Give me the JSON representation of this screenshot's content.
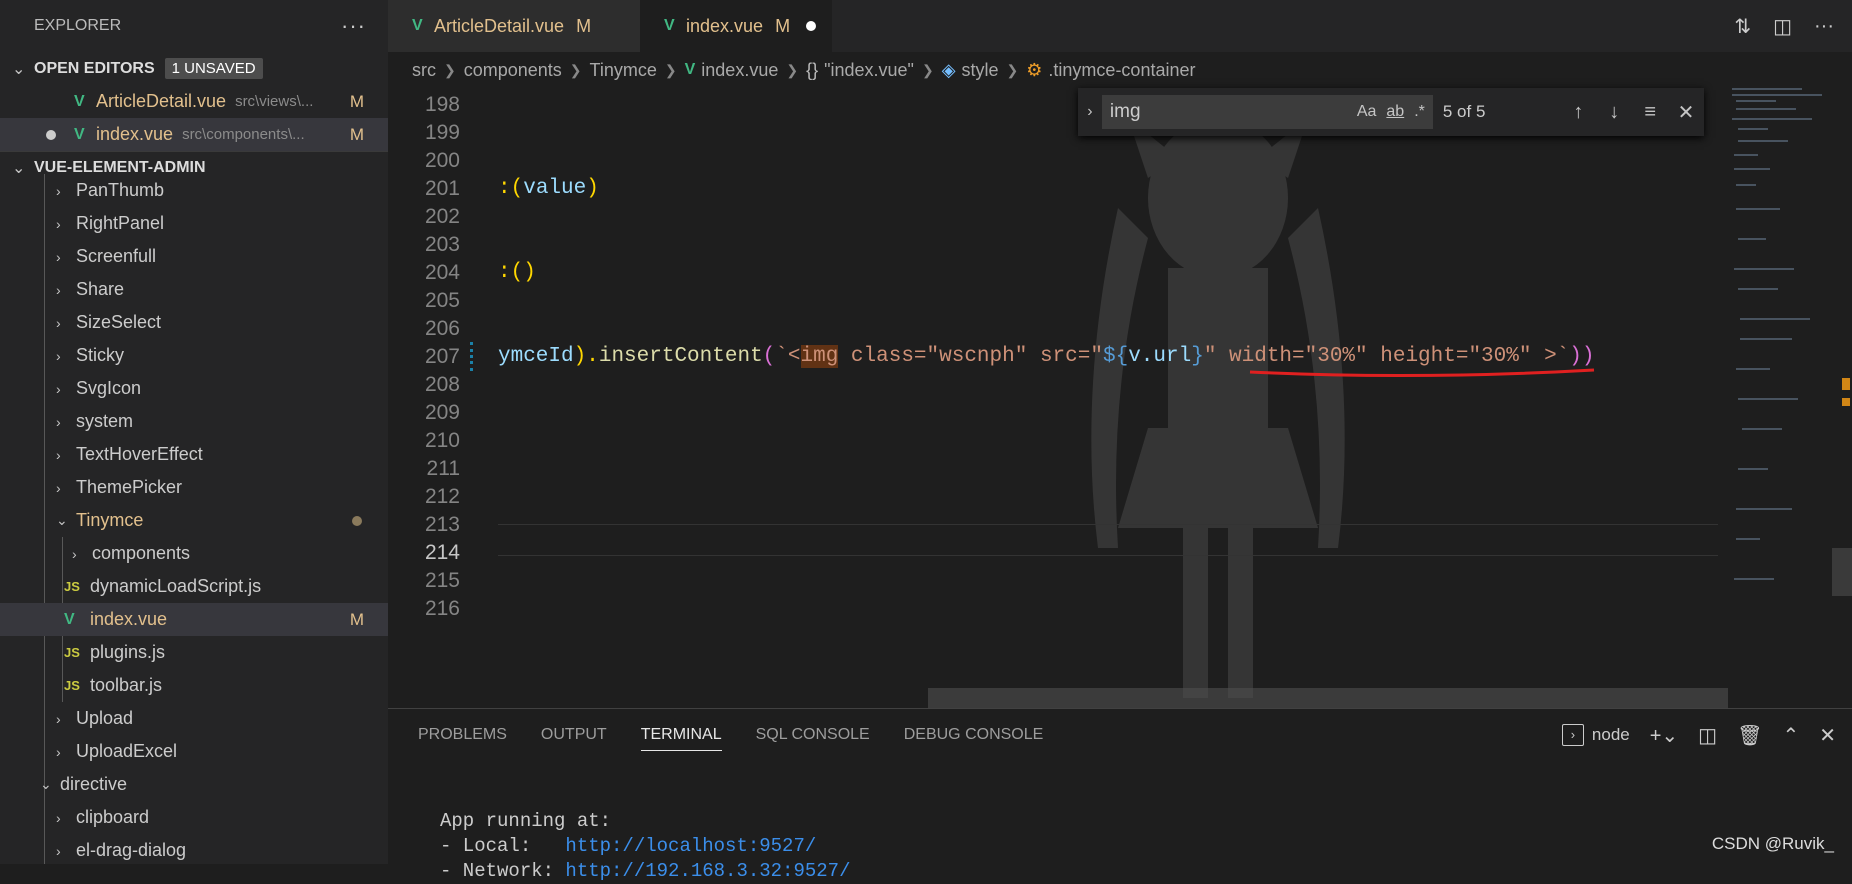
{
  "explorer": {
    "title": "EXPLORER",
    "more": "···",
    "open_editors": {
      "label": "OPEN EDITORS",
      "badge": "1 UNSAVED",
      "items": [
        {
          "name": "ArticleDetail.vue",
          "path": "src\\views\\...",
          "status": "M"
        },
        {
          "name": "index.vue",
          "path": "src\\components\\...",
          "status": "M"
        }
      ]
    },
    "project": {
      "label": "VUE-ELEMENT-ADMIN",
      "items": [
        {
          "name": "PanThumb"
        },
        {
          "name": "RightPanel"
        },
        {
          "name": "Screenfull"
        },
        {
          "name": "Share"
        },
        {
          "name": "SizeSelect"
        },
        {
          "name": "Sticky"
        },
        {
          "name": "SvgIcon"
        },
        {
          "name": "system"
        },
        {
          "name": "TextHoverEffect"
        },
        {
          "name": "ThemePicker"
        },
        {
          "name": "Tinymce"
        },
        {
          "name": "components"
        },
        {
          "name": "dynamicLoadScript.js"
        },
        {
          "name": "index.vue",
          "status": "M"
        },
        {
          "name": "plugins.js"
        },
        {
          "name": "toolbar.js"
        },
        {
          "name": "Upload"
        },
        {
          "name": "UploadExcel"
        },
        {
          "name": "directive"
        },
        {
          "name": "clipboard"
        },
        {
          "name": "el-drag-dialog"
        }
      ]
    }
  },
  "tabs": [
    {
      "label": "ArticleDetail.vue",
      "status": "M"
    },
    {
      "label": "index.vue",
      "status": "M"
    }
  ],
  "breadcrumb": {
    "parts": [
      "src",
      "components",
      "Tinymce",
      "index.vue",
      "\"index.vue\"",
      "style",
      ".tinymce-container"
    ]
  },
  "find": {
    "query": "img",
    "opt_case": "Aa",
    "opt_word": "ab",
    "opt_regex": ".*",
    "count": "5 of 5"
  },
  "editor": {
    "line_numbers": [
      "198",
      "199",
      "200",
      "201",
      "202",
      "203",
      "204",
      "205",
      "206",
      "207",
      "208",
      "209",
      "210",
      "211",
      "212",
      "213",
      "214",
      "215",
      "216"
    ],
    "line201": {
      "a": ":(",
      "b": "value",
      "c": ")"
    },
    "line204": {
      "a": ":()"
    },
    "line207": {
      "p1": "ymceId",
      "p2": ").",
      "p3": "insertContent",
      "p4": "(",
      "p5": "`<",
      "p6": "img",
      "p7": " class=\"wscnph\" src=\"",
      "p8": "${",
      "p9": "v.url",
      "p10": "}",
      "p11": "\" width=\"30%\" height=\"30%\" >`",
      "p12": "))"
    }
  },
  "panel": {
    "tabs": [
      "PROBLEMS",
      "OUTPUT",
      "TERMINAL",
      "SQL CONSOLE",
      "DEBUG CONSOLE"
    ],
    "terminal_name": "node",
    "terminal_lines": {
      "l1": "App running at:",
      "l2a": "- Local:   ",
      "l2b": "http://localhost:9527/",
      "l3a": "- Network: ",
      "l3b": "http://192.168.3.32:9527/"
    }
  },
  "watermark": "CSDN @Ruvik_"
}
